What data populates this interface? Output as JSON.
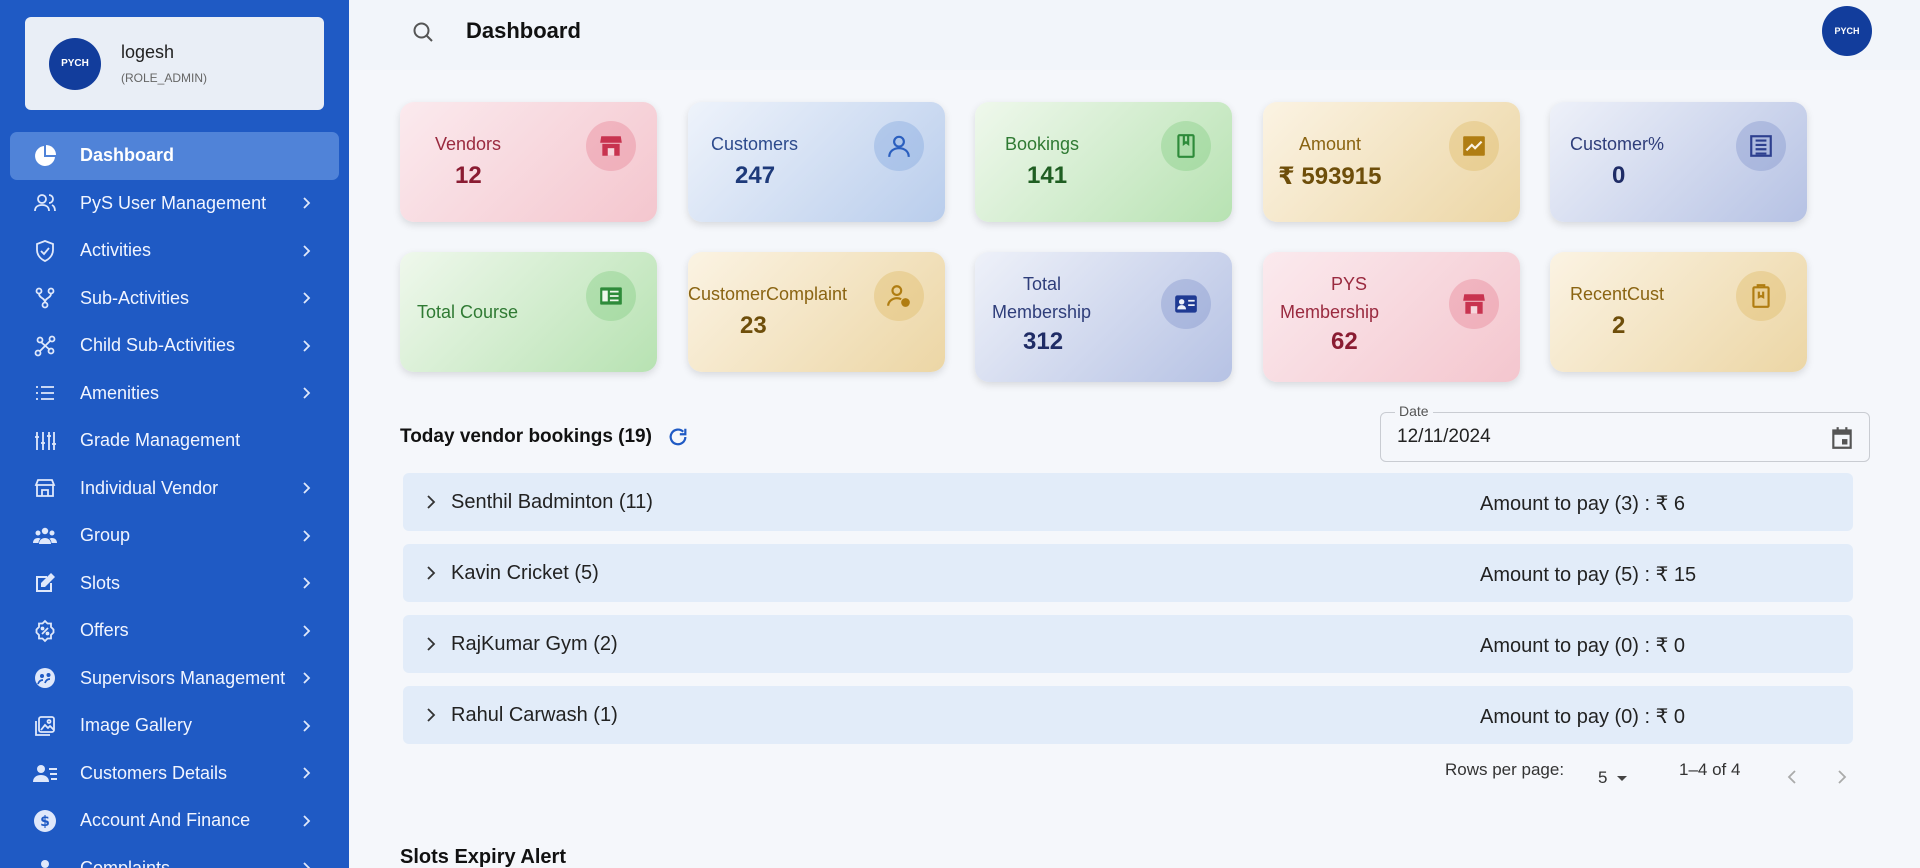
{
  "profile": {
    "name": "logesh",
    "role": "(ROLE_ADMIN)",
    "avatar_text": "PYCH"
  },
  "sidebar": {
    "items": [
      {
        "label": "Dashboard",
        "icon": "pie-chart-icon",
        "active": true,
        "chevron": false
      },
      {
        "label": "PyS User Management",
        "icon": "users-icon",
        "chevron": true
      },
      {
        "label": "Activities",
        "icon": "shield-icon",
        "chevron": true
      },
      {
        "label": "Sub-Activities",
        "icon": "branch-icon",
        "chevron": true
      },
      {
        "label": "Child Sub-Activities",
        "icon": "network-icon",
        "chevron": true
      },
      {
        "label": "Amenities",
        "icon": "list-icon",
        "chevron": true
      },
      {
        "label": "Grade Management",
        "icon": "sliders-icon",
        "chevron": false
      },
      {
        "label": "Individual Vendor",
        "icon": "store-icon",
        "chevron": true
      },
      {
        "label": "Group",
        "icon": "group-icon",
        "chevron": true
      },
      {
        "label": "Slots",
        "icon": "edit-icon",
        "chevron": true
      },
      {
        "label": "Offers",
        "icon": "badge-icon",
        "chevron": true
      },
      {
        "label": "Supervisors Management",
        "icon": "supervisor-icon",
        "chevron": true
      },
      {
        "label": "Image Gallery",
        "icon": "gallery-icon",
        "chevron": true
      },
      {
        "label": "Customers Details",
        "icon": "customer-icon",
        "chevron": true
      },
      {
        "label": "Account And Finance",
        "icon": "dollar-icon",
        "chevron": true
      },
      {
        "label": "Complaints",
        "icon": "complaint-icon",
        "chevron": true
      }
    ]
  },
  "header": {
    "title": "Dashboard",
    "avatar_text": "PYCH"
  },
  "cards": [
    {
      "label": "Vendors",
      "value": "12",
      "theme": "pink",
      "icon": "store-icon",
      "accent": "#c8334f",
      "label_color": "#9a2a3f",
      "value_color": "#8a1c32"
    },
    {
      "label": "Customers",
      "value": "247",
      "theme": "blue",
      "icon": "person-icon",
      "accent": "#2b5fbf",
      "label_color": "#2c4a8c",
      "value_color": "#1e3a7a"
    },
    {
      "label": "Bookings",
      "value": "141",
      "theme": "green",
      "icon": "book-icon",
      "accent": "#2e8b3a",
      "label_color": "#2f7a33",
      "value_color": "#1f5e22"
    },
    {
      "label": "Amount",
      "value": "₹ 593915",
      "theme": "gold",
      "icon": "chart-icon",
      "accent": "#b07d12",
      "label_color": "#8a6412",
      "value_color": "#6e4e0a"
    },
    {
      "label": "Customer%",
      "value": "0",
      "theme": "slate",
      "icon": "percent-icon",
      "accent": "#2d3f8f",
      "label_color": "#2e3d7a",
      "value_color": "#1f2c66"
    },
    {
      "label": "Total Course",
      "value": "",
      "theme": "green",
      "icon": "course-icon",
      "accent": "#2e8b3a",
      "label_color": "#2f7a33",
      "value_color": "#1f5e22"
    },
    {
      "label": "CustomerComplaint",
      "value": "23",
      "theme": "gold",
      "icon": "complaint-person-icon",
      "accent": "#b07d12",
      "label_color": "#8a6412",
      "value_color": "#6e4e0a"
    },
    {
      "label": "Total",
      "label2": "Membership",
      "value": "312",
      "theme": "slate",
      "icon": "membership-icon",
      "accent": "#1f3a93",
      "label_color": "#2e3d7a",
      "value_color": "#1f2c66"
    },
    {
      "label": "PYS",
      "label2": "Membership",
      "value": "62",
      "theme": "pink",
      "icon": "store-icon",
      "accent": "#c8334f",
      "label_color": "#9a2a3f",
      "value_color": "#8a1c32"
    },
    {
      "label": "RecentCust",
      "value": "2",
      "theme": "gold",
      "icon": "clipboard-icon",
      "accent": "#b07d12",
      "label_color": "#8a6412",
      "value_color": "#6e4e0a"
    }
  ],
  "bookings": {
    "title": "Today vendor bookings (19)",
    "date_label": "Date",
    "date_value": "12/11/2024",
    "rows": [
      {
        "name": "Senthil Badminton (11)",
        "amount": "Amount to pay (3) : ₹ 6"
      },
      {
        "name": "Kavin Cricket (5)",
        "amount": "Amount to pay (5) : ₹ 15"
      },
      {
        "name": "RajKumar Gym (2)",
        "amount": "Amount to pay (0) : ₹ 0"
      },
      {
        "name": "Rahul Carwash (1)",
        "amount": "Amount to pay (0) : ₹ 0"
      }
    ],
    "pagination": {
      "rows_per_page_label": "Rows per page:",
      "rows_per_page": "5",
      "range": "1–4 of 4"
    }
  },
  "slots_alert": {
    "title": "Slots Expiry Alert"
  }
}
